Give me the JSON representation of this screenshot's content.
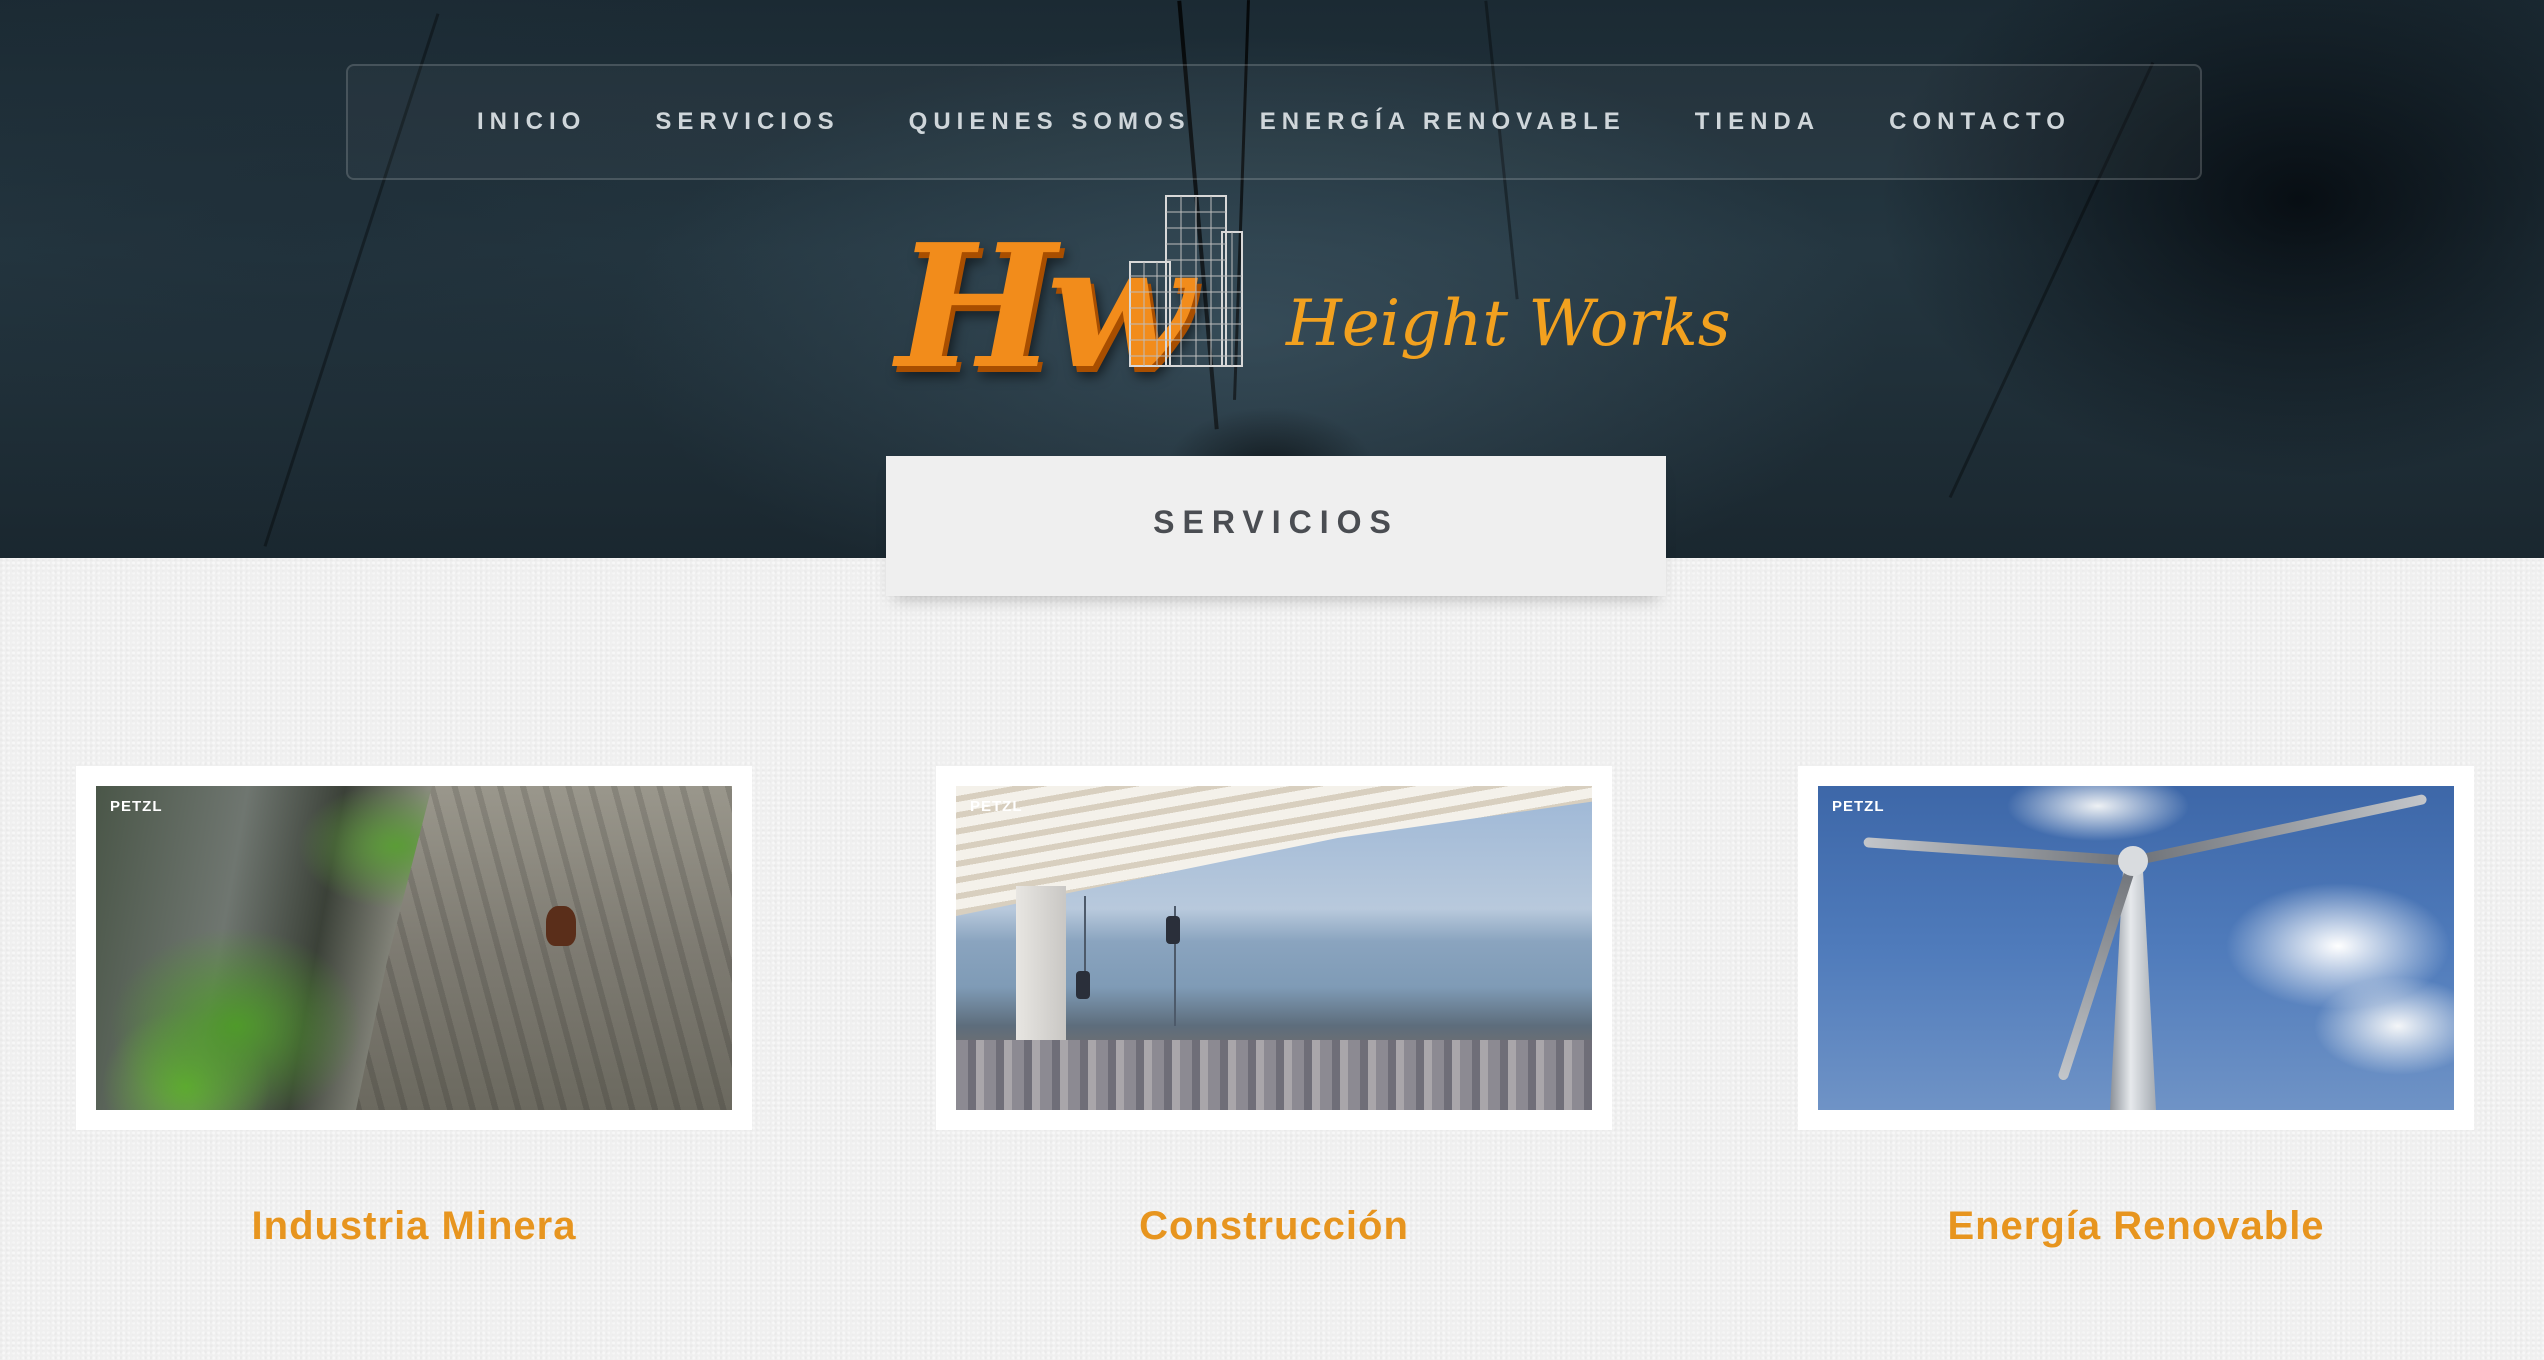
{
  "nav": {
    "items": [
      {
        "label": "INICIO"
      },
      {
        "label": "SERVICIOS"
      },
      {
        "label": "QUIENES SOMOS"
      },
      {
        "label": "ENERGÍA RENOVABLE"
      },
      {
        "label": "TIENDA"
      },
      {
        "label": "CONTACTO"
      }
    ]
  },
  "logo": {
    "monogram": "Hw",
    "text": "Height Works"
  },
  "section": {
    "title": "SERVICIOS"
  },
  "services": [
    {
      "title": "Industria Minera",
      "watermark": "PETZL"
    },
    {
      "title": "Construcción",
      "watermark": "PETZL"
    },
    {
      "title": "Energía Renovable",
      "watermark": "PETZL"
    }
  ],
  "colors": {
    "accent": "#e7951f",
    "nav_text": "#cfd6da",
    "section_title": "#4a4d52",
    "background": "#efefef"
  }
}
